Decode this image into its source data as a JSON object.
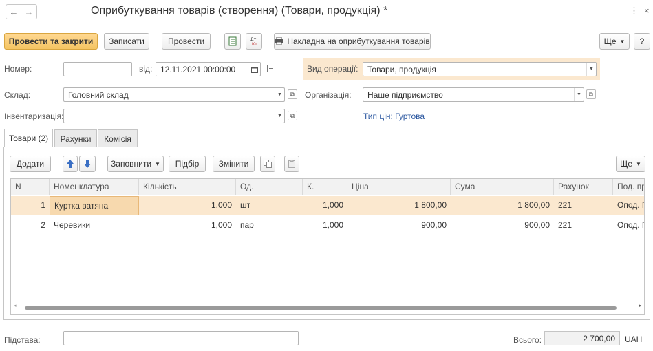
{
  "window": {
    "title": "Оприбуткування товарів (створення) (Товари, продукція) *",
    "back_icon": "←",
    "forward_icon": "→",
    "more_icon": "⋮",
    "close_icon": "×"
  },
  "toolbar": {
    "post_close": "Провести та закрити",
    "save": "Записати",
    "post": "Провести",
    "print_invoice": "Накладна на оприбуткування товарів",
    "more": "Ще",
    "help": "?"
  },
  "form": {
    "number_label": "Номер:",
    "number_value": "",
    "date_label": "від:",
    "date_value": "12.11.2021 00:00:00",
    "operation_label": "Вид операції:",
    "operation_value": "Товари, продукція",
    "warehouse_label": "Склад:",
    "warehouse_value": "Головний склад",
    "organization_label": "Організація:",
    "organization_value": "Наше підприємство",
    "inventory_label": "Інвентаризація:",
    "inventory_value": "",
    "price_type_link": "Тип цін: Гуртова"
  },
  "tabs": [
    {
      "label": "Товари (2)"
    },
    {
      "label": "Рахунки"
    },
    {
      "label": "Комісія"
    }
  ],
  "table_toolbar": {
    "add": "Додати",
    "fill": "Заповнити",
    "select": "Підбір",
    "change": "Змінити",
    "more": "Ще"
  },
  "table": {
    "columns": [
      "N",
      "Номенклатура",
      "Кількість",
      "Од.",
      "К.",
      "Ціна",
      "Сума",
      "Рахунок",
      "Под. пр"
    ],
    "rows": [
      {
        "n": "1",
        "item": "Куртка ватяна",
        "qty": "1,000",
        "unit": "шт",
        "k": "1,000",
        "price": "1 800,00",
        "sum": "1 800,00",
        "account": "221",
        "tax": "Опод. П"
      },
      {
        "n": "2",
        "item": "Черевики",
        "qty": "1,000",
        "unit": "пар",
        "k": "1,000",
        "price": "900,00",
        "sum": "900,00",
        "account": "221",
        "tax": "Опод. П"
      }
    ]
  },
  "footer": {
    "basis_label": "Підстава:",
    "basis_value": "",
    "total_label": "Всього:",
    "total_value": "2 700,00",
    "currency": "UAH"
  },
  "colors": {
    "accent": "#f5c563",
    "selection": "#fbe8cf",
    "link": "#2c58a0"
  }
}
